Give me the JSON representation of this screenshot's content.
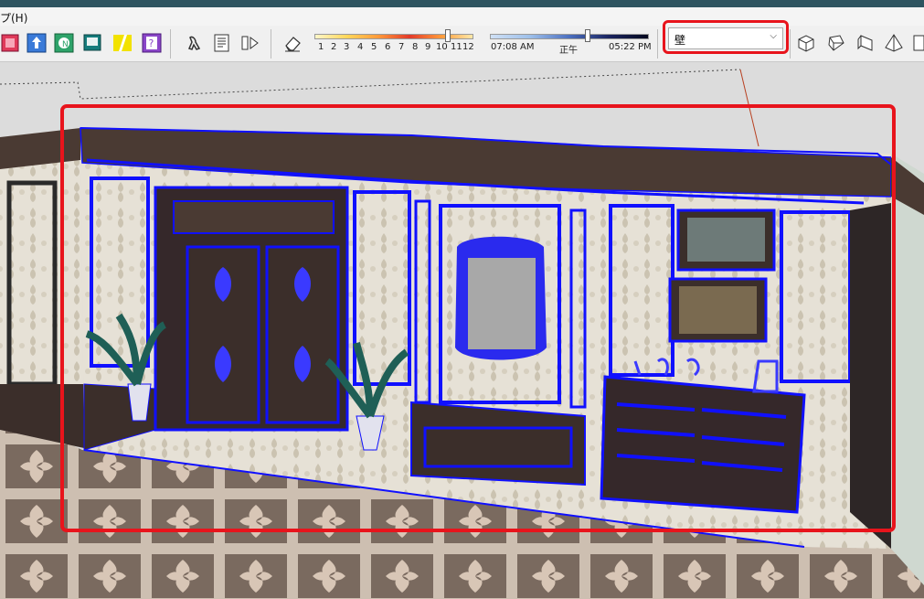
{
  "menu": {
    "help_label": "プ(H)"
  },
  "toolbar": {
    "icons": [
      "layer-icon",
      "section-icon",
      "nav-icon",
      "monitor-icon",
      "stripe-icon",
      "help-box-icon",
      "walk-icon",
      "page-icon",
      "scene-icon",
      "eraser-icon"
    ],
    "month_slider": {
      "labels": [
        "1",
        "2",
        "3",
        "4",
        "5",
        "6",
        "7",
        "8",
        "9",
        "10",
        "11",
        "12"
      ],
      "value": 11
    },
    "time_slider": {
      "start_label": "07:08 AM",
      "mid_label": "正午",
      "end_label": "05:22 PM"
    },
    "tag_combo": {
      "value": "壁"
    },
    "view_icons": [
      "iso-view-icon",
      "top-view-icon",
      "front-view-icon",
      "right-view-icon",
      "back-view-icon"
    ]
  },
  "colors": {
    "highlight": "#e8141c",
    "selection": "#1010ff",
    "titlebar": "#2e5460"
  }
}
